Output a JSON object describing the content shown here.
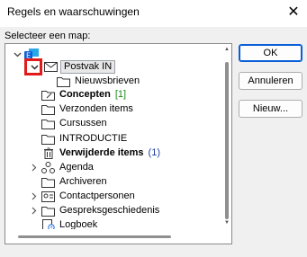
{
  "window": {
    "title": "Regels en waarschuwingen",
    "close_label": "✕"
  },
  "prompt": "Selecteer een map:",
  "tree": {
    "items": [
      {
        "label": "Postvak IN"
      },
      {
        "label": "Nieuwsbrieven"
      },
      {
        "label": "Concepten",
        "count": "[1]"
      },
      {
        "label": "Verzonden items"
      },
      {
        "label": "Cursussen"
      },
      {
        "label": "INTRODUCTIE"
      },
      {
        "label": "Verwijderde items",
        "count": "(1)"
      },
      {
        "label": "Agenda"
      },
      {
        "label": "Archiveren"
      },
      {
        "label": "Contactpersonen"
      },
      {
        "label": "Gespreksgeschiedenis"
      },
      {
        "label": "Logboek"
      }
    ]
  },
  "buttons": {
    "ok": "OK",
    "cancel": "Annuleren",
    "new": "Nieuw..."
  },
  "colors": {
    "highlight_box": "#e11a1a",
    "count_green": "#1a8a1a",
    "count_blue": "#1f3aa8",
    "ok_border": "#0a5fd8"
  }
}
